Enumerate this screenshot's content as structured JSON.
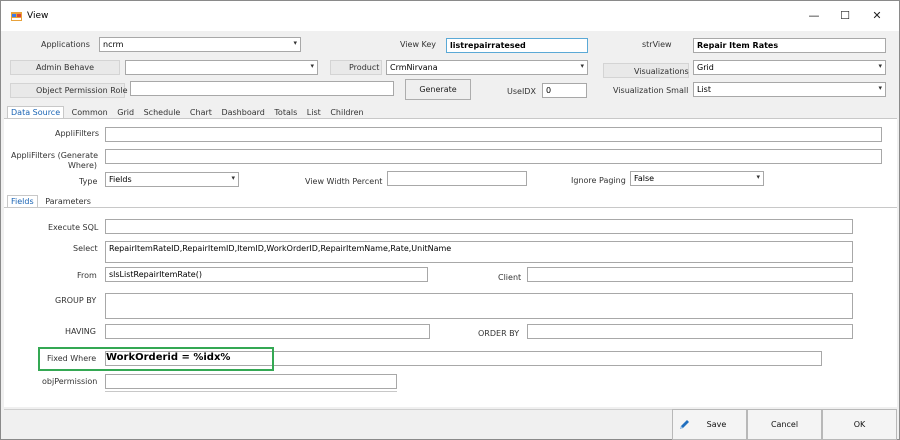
{
  "window": {
    "title": "View",
    "minimize": "—",
    "maximize": "☐",
    "close": "✕"
  },
  "header": {
    "applications_label": "Applications",
    "applications_value": "ncrm",
    "view_key_label": "View Key",
    "view_key_value": "listrepairratesed",
    "strview_label": "strView",
    "strview_value": "Repair Item Rates",
    "admin_behave_label": "Admin Behave",
    "admin_behave_value": "",
    "product_label": "Product",
    "product_value": "CrmNirvana",
    "visualizations_label": "Visualizations",
    "visualizations_value": "Grid",
    "object_permission_label": "Object Permission Role",
    "object_permission_value": "",
    "generate_label": "Generate",
    "useidx_label": "UseIDX",
    "useidx_value": "0",
    "visualization_small_label": "Visualization Small",
    "visualization_small_value": "List"
  },
  "main_tabs": [
    "Data Source",
    "Common",
    "Grid",
    "Schedule",
    "Chart",
    "Dashboard",
    "Totals",
    "List",
    "Children"
  ],
  "datasource": {
    "applifilters_label": "AppliFilters",
    "applifilters_value": "",
    "applifilters_gen_label_1": "AppliFilters (Generate",
    "applifilters_gen_label_2": "Where)",
    "applifilters_gen_value": "",
    "type_label": "Type",
    "type_value": "Fields",
    "view_width_label": "View Width Percent",
    "view_width_value": "",
    "ignore_paging_label": "Ignore Paging",
    "ignore_paging_value": "False"
  },
  "sub_tabs": [
    "Fields",
    "Parameters"
  ],
  "fields": {
    "execute_sql_label": "Execute SQL",
    "execute_sql_value": "",
    "select_label": "Select",
    "select_value": "RepairItemRateID,RepairItemID,ItemID,WorkOrderID,RepairItemName,Rate,UnitName",
    "from_label": "From",
    "from_value": "slsListRepairItemRate()",
    "client_label": "Client",
    "client_value": "",
    "group_by_label": "GROUP BY",
    "group_by_value": "",
    "having_label": "HAVING",
    "having_value": "",
    "order_by_label": "ORDER BY",
    "order_by_value": "",
    "fixed_where_label": "Fixed Where",
    "fixed_where_value": "WorkOrderid = %idx%",
    "obj_permission_label": "objPermission",
    "obj_permission_value": ""
  },
  "footer": {
    "save_label": "Save",
    "cancel_label": "Cancel",
    "ok_label": "OK"
  },
  "colors": {
    "highlight": "#34a853",
    "active_tab": "#1a64b4",
    "save_icon": "#1f6fbf"
  }
}
